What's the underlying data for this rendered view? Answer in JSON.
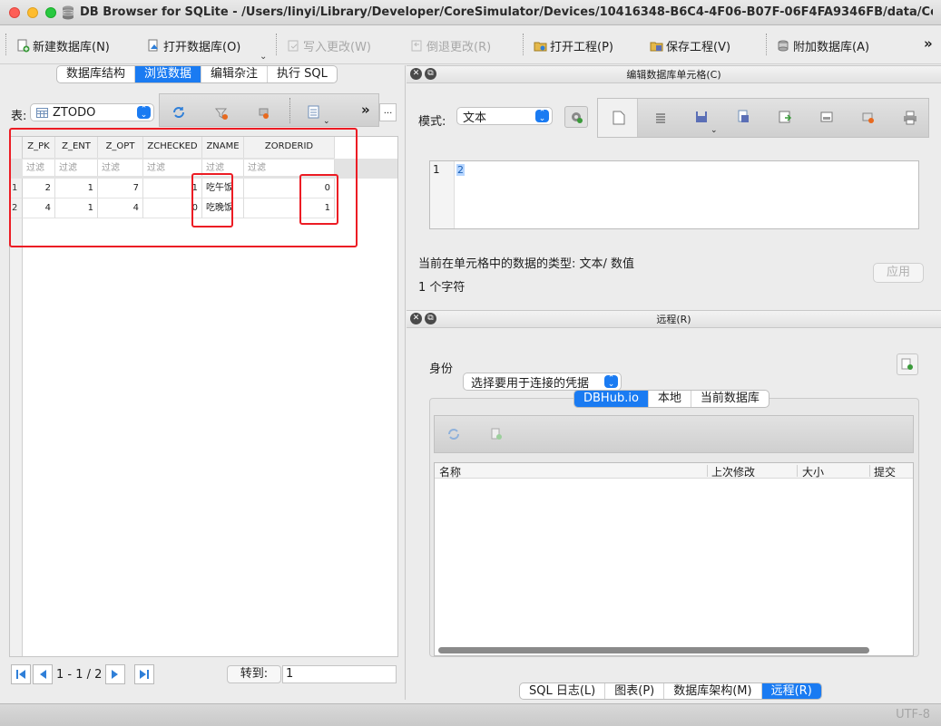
{
  "window": {
    "title": "DB Browser for SQLite - /Users/linyi/Library/Developer/CoreSimulator/Devices/10416348-B6C4-4F06-B07F-06F4FA9346FB/data/Containers/Data/..."
  },
  "toolbar": {
    "new_db": "新建数据库(N)",
    "open_db": "打开数据库(O)",
    "write_changes": "写入更改(W)",
    "revert_changes": "倒退更改(R)",
    "open_project": "打开工程(P)",
    "save_project": "保存工程(V)",
    "attach_db": "附加数据库(A)",
    "overflow": "»"
  },
  "left": {
    "tabs": [
      {
        "label": "数据库结构"
      },
      {
        "label": "浏览数据"
      },
      {
        "label": "编辑杂注"
      },
      {
        "label": "执行 SQL"
      }
    ],
    "table_label": "表:",
    "table_selected": "ZTODO",
    "more_label": "»",
    "ellipsis": "...",
    "columns": [
      "Z_PK",
      "Z_ENT",
      "Z_OPT",
      "ZCHECKED",
      "ZNAME",
      "ZORDERID"
    ],
    "filter_placeholder": "过滤",
    "rows": [
      {
        "num": "1",
        "cells": [
          "2",
          "1",
          "7",
          "1",
          "吃午饭",
          "0"
        ]
      },
      {
        "num": "2",
        "cells": [
          "4",
          "1",
          "4",
          "0",
          "吃晚饭",
          "1"
        ]
      }
    ],
    "pager": {
      "range": "1 - 1 / 2",
      "goto_label": "转到:",
      "goto_value": "1"
    }
  },
  "editor": {
    "title": "编辑数据库单元格(C)",
    "mode_label": "模式:",
    "mode_value": "文本",
    "line_number": "1",
    "cell_value": "2",
    "type_info": "当前在单元格中的数据的类型: 文本/ 数值",
    "char_count": "1 个字符",
    "apply": "应用"
  },
  "remote": {
    "title": "远程(R)",
    "identity_label": "身份",
    "identity_value": "选择要用于连接的凭据",
    "tabs": [
      {
        "label": "DBHub.io"
      },
      {
        "label": "本地"
      },
      {
        "label": "当前数据库"
      }
    ],
    "columns": [
      "名称",
      "上次修改",
      "大小",
      "提交"
    ]
  },
  "bottom_tabs": [
    {
      "label": "SQL 日志(L)"
    },
    {
      "label": "图表(P)"
    },
    {
      "label": "数据库架构(M)"
    },
    {
      "label": "远程(R)"
    }
  ],
  "status": {
    "encoding": "UTF-8"
  },
  "colors": {
    "accent": "#1a7bf2",
    "highlight_box": "#ec1c24"
  }
}
